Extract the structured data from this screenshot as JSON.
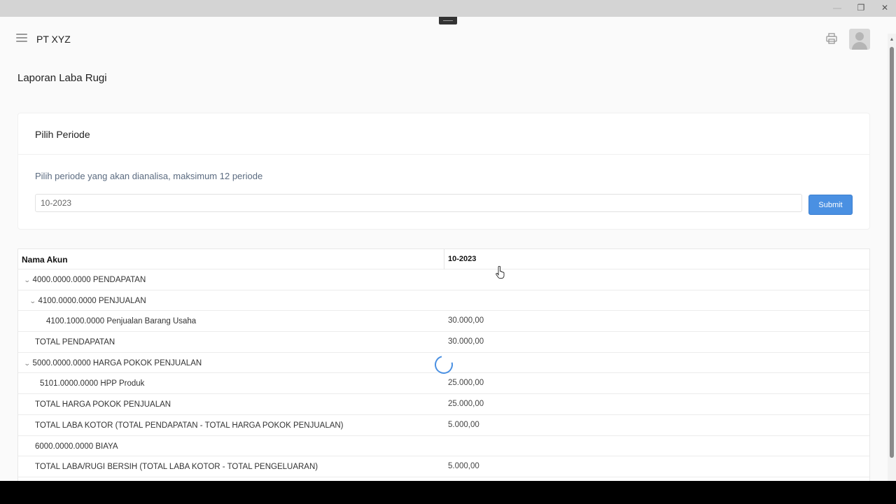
{
  "window": {
    "min_icon": "minimize-icon",
    "max_icon": "restore-icon",
    "close_icon": "close-icon"
  },
  "header": {
    "title": "PT XYZ",
    "menu_icon": "hamburger-menu-icon",
    "print_icon": "printer-icon",
    "avatar_icon": "user-avatar"
  },
  "page": {
    "title": "Laporan Laba Rugi"
  },
  "period_card": {
    "title": "Pilih Periode",
    "description": "Pilih periode yang akan dianalisa, maksimum 12 periode",
    "input_value": "10-2023",
    "submit_label": "Submit"
  },
  "report": {
    "columns": [
      "Nama Akun",
      "10-2023"
    ],
    "rows": [
      {
        "name": "4000.0000.0000 PENDAPATAN",
        "value": "",
        "expandable": true
      },
      {
        "name": "4100.0000.0000 PENJUALAN",
        "value": "",
        "expandable": true
      },
      {
        "name": "4100.1000.0000 Penjualan Barang Usaha",
        "value": "30.000,00",
        "expandable": false
      },
      {
        "name": "TOTAL PENDAPATAN",
        "value": "30.000,00",
        "expandable": false
      },
      {
        "name": "5000.0000.0000 HARGA POKOK PENJUALAN",
        "value": "",
        "expandable": true
      },
      {
        "name": "5101.0000.0000 HPP Produk",
        "value": "25.000,00",
        "expandable": false
      },
      {
        "name": "TOTAL HARGA POKOK PENJUALAN",
        "value": "25.000,00",
        "expandable": false
      },
      {
        "name": "TOTAL LABA KOTOR (TOTAL PENDAPATAN - TOTAL HARGA POKOK PENJUALAN)",
        "value": "5.000,00",
        "expandable": false
      },
      {
        "name": "6000.0000.0000 BIAYA",
        "value": "",
        "expandable": false
      },
      {
        "name": "TOTAL LABA/RUGI BERSIH (TOTAL LABA KOTOR - TOTAL PENGELUARAN)",
        "value": "5.000,00",
        "expandable": false
      }
    ]
  },
  "colors": {
    "accent": "#4a90e2",
    "background": "#fafafa",
    "description_text": "#5b6b80"
  }
}
